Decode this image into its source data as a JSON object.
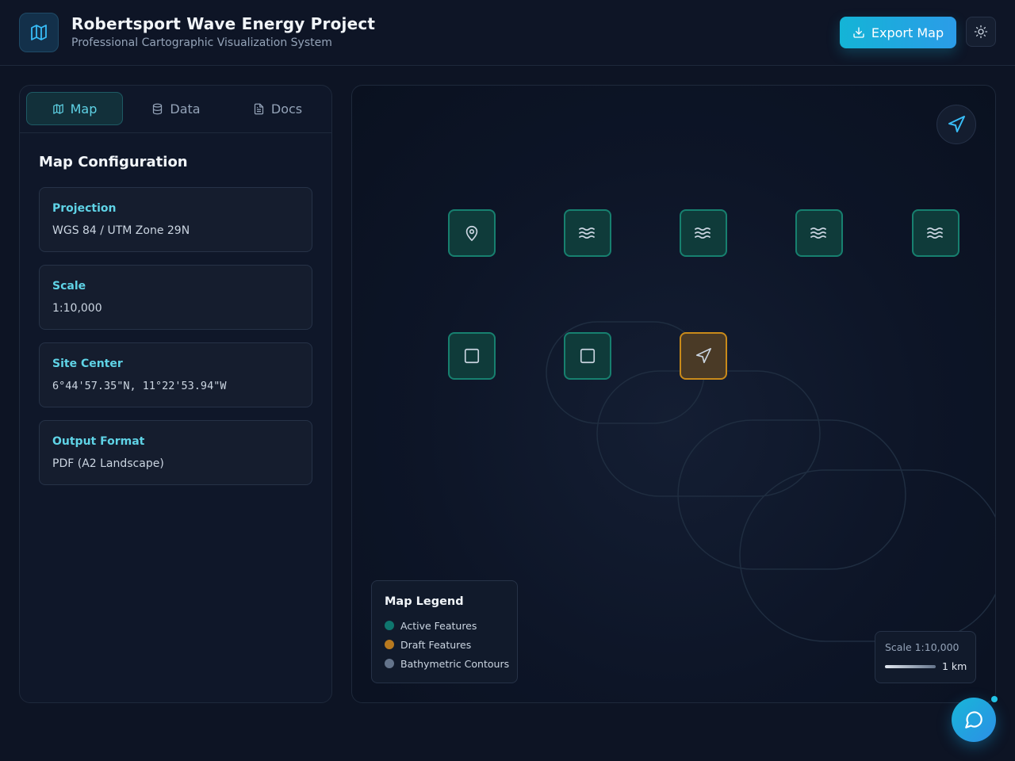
{
  "header": {
    "title": "Robertsport Wave Energy Project",
    "subtitle": "Professional Cartographic Visualization System",
    "export_label": "Export Map",
    "logo_icon": "map-icon",
    "theme_icon": "sun-icon"
  },
  "tabs": [
    {
      "label": "Map",
      "icon": "map-icon",
      "active": true
    },
    {
      "label": "Data",
      "icon": "database-icon",
      "active": false
    },
    {
      "label": "Docs",
      "icon": "file-text-icon",
      "active": false
    }
  ],
  "config": {
    "title": "Map Configuration",
    "items": [
      {
        "label": "Projection",
        "value": "WGS 84 / UTM Zone 29N"
      },
      {
        "label": "Scale",
        "value": "1:10,000"
      },
      {
        "label": "Site Center",
        "value": "6°44'57.35\"N, 11°22'53.94\"W"
      },
      {
        "label": "Output Format",
        "value": "PDF (A2 Landscape)"
      }
    ]
  },
  "map": {
    "features": [
      {
        "icon": "map-pin-icon",
        "status": "active"
      },
      {
        "icon": "waves-icon",
        "status": "active"
      },
      {
        "icon": "waves-icon",
        "status": "active"
      },
      {
        "icon": "waves-icon",
        "status": "active"
      },
      {
        "icon": "waves-icon",
        "status": "active"
      },
      {
        "icon": "square-icon",
        "status": "active"
      },
      {
        "icon": "square-icon",
        "status": "active"
      },
      {
        "icon": "navigation-icon",
        "status": "draft"
      }
    ],
    "legend": {
      "title": "Map Legend",
      "items": [
        {
          "label": "Active Features",
          "color": "#0f766e"
        },
        {
          "label": "Draft Features",
          "color": "#b7791f"
        },
        {
          "label": "Bathymetric Contours",
          "color": "#64748b"
        }
      ]
    },
    "scale": {
      "label": "Scale 1:10,000",
      "unit": "1 km"
    }
  },
  "colors": {
    "accent": "#22c3e6",
    "active": "#17806f",
    "draft": "#c98a1a"
  }
}
